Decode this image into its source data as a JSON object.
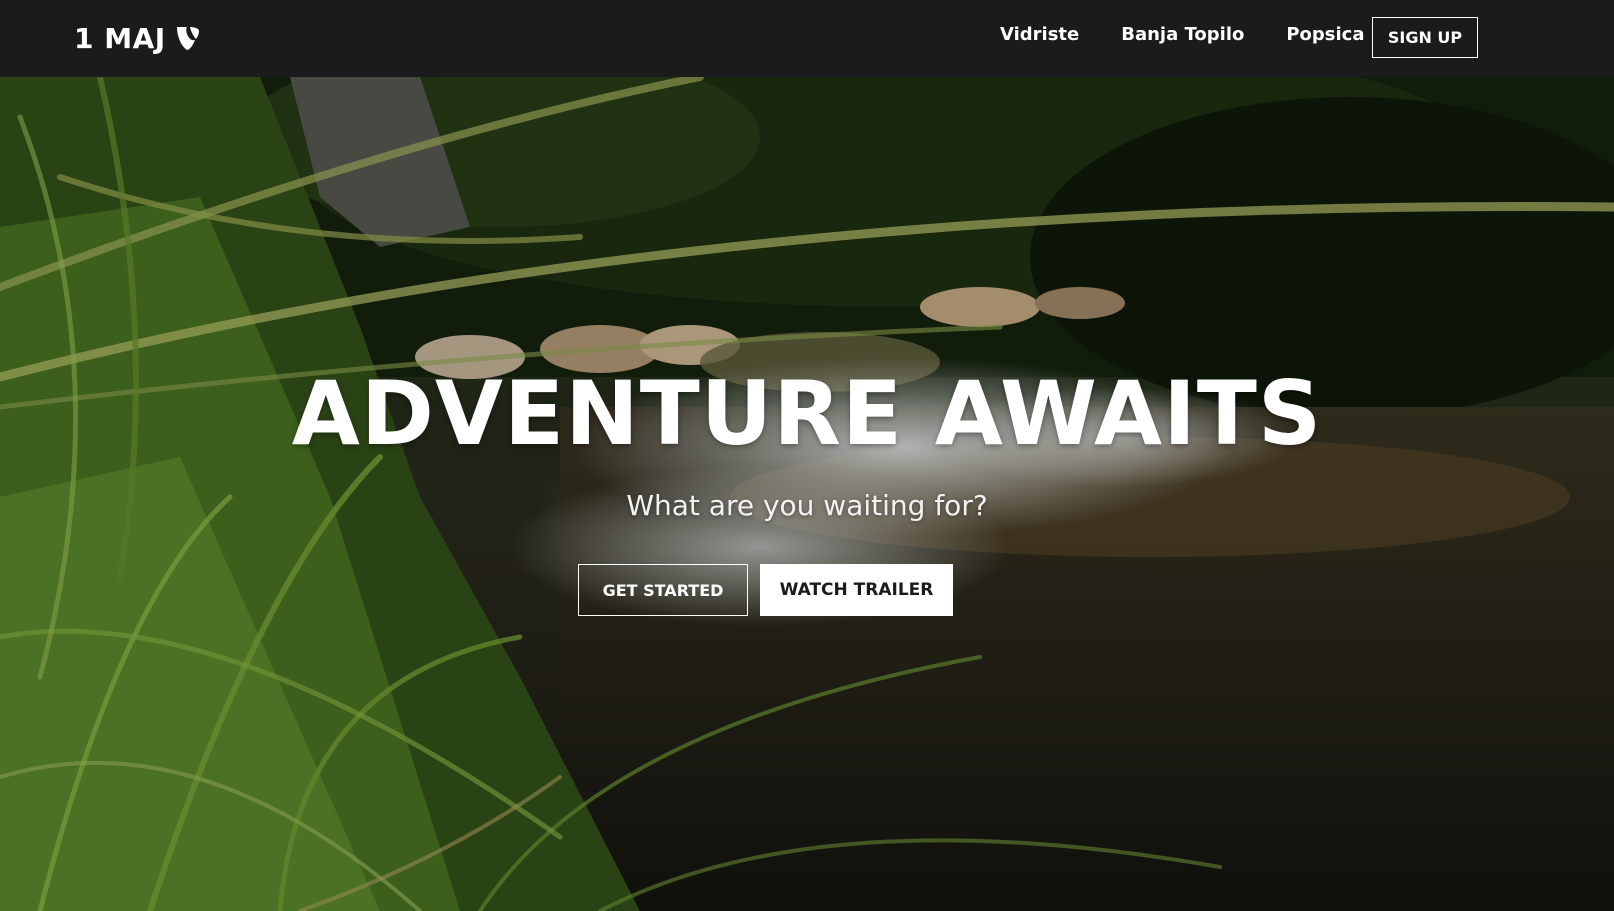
{
  "nav": {
    "brand_text": "1 MAJ",
    "brand_icon": "typo3-logo-icon",
    "links": [
      "Vidriste",
      "Banja Topilo",
      "Popsica"
    ],
    "signup_label": "SIGN UP"
  },
  "hero": {
    "title": "ADVENTURE AWAITS",
    "subtitle": "What are you waiting for?",
    "primary_label": "GET STARTED",
    "secondary_label": "WATCH TRAILER",
    "background": "waterfall-stream-grass-photo"
  },
  "colors": {
    "navbar_bg": "#1b1a1c",
    "text": "#ffffff",
    "button_solid_bg": "#ffffff",
    "button_solid_text": "#1b1a1c"
  }
}
